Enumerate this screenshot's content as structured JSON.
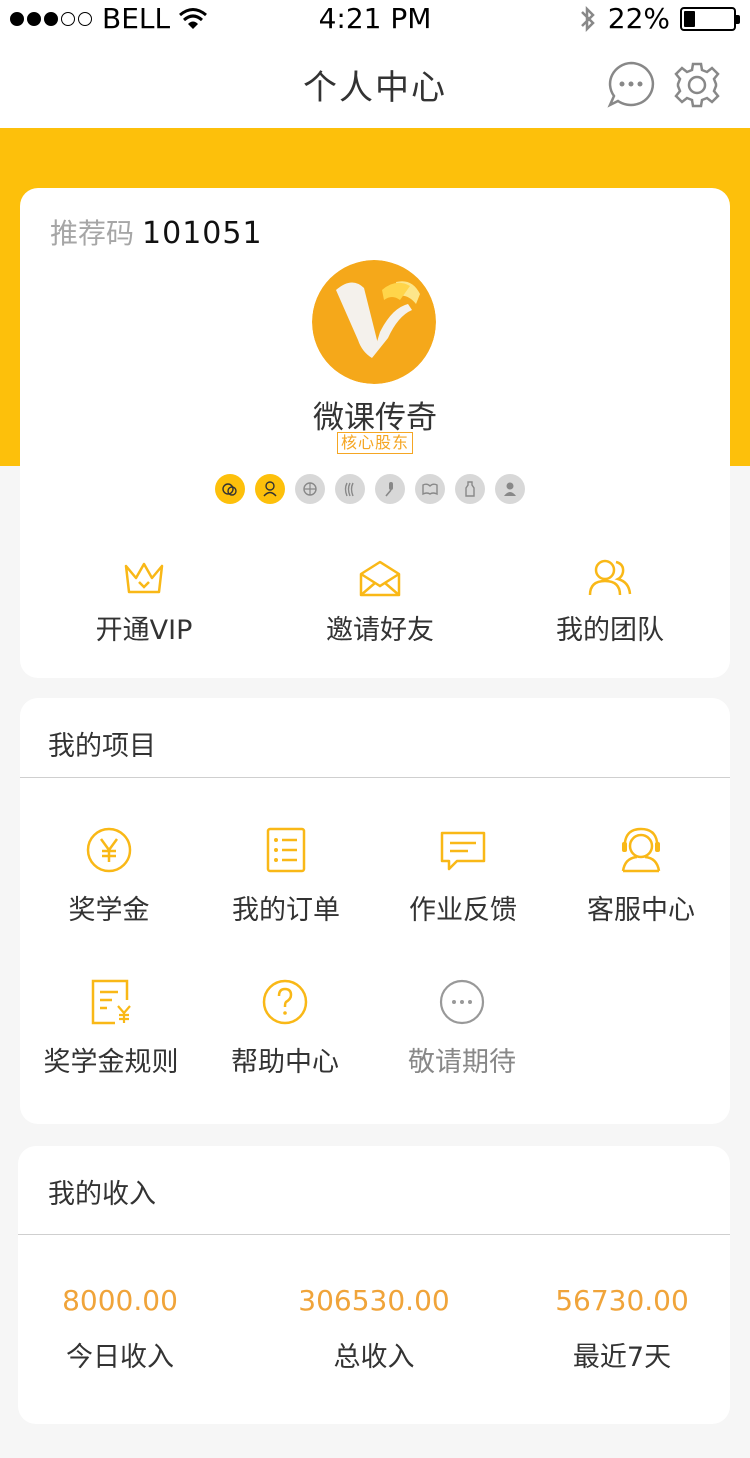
{
  "status_bar": {
    "carrier": "BELL",
    "time": "4:21 PM",
    "battery_percent": "22%",
    "battery_level": 0.22
  },
  "nav": {
    "title": "个人中心",
    "icons": [
      "message-icon",
      "gear-icon"
    ]
  },
  "profile": {
    "ref_label": "推荐码",
    "ref_code": "101051",
    "name": "微课传奇",
    "role": "核心股东",
    "badges": [
      {
        "icon": "wechat-icon",
        "active": true
      },
      {
        "icon": "person-chat-icon",
        "active": true
      },
      {
        "icon": "globe-icon",
        "active": false
      },
      {
        "icon": "hair-icon",
        "active": false
      },
      {
        "icon": "microphone-icon",
        "active": false
      },
      {
        "icon": "book-icon",
        "active": false
      },
      {
        "icon": "bottle-icon",
        "active": false
      },
      {
        "icon": "user-icon",
        "active": false
      }
    ]
  },
  "quick_actions": [
    {
      "label": "开通VIP",
      "icon": "crown-icon"
    },
    {
      "label": "邀请好友",
      "icon": "envelope-icon"
    },
    {
      "label": "我的团队",
      "icon": "team-icon"
    }
  ],
  "projects": {
    "title": "我的项目",
    "items": [
      {
        "label": "奖学金",
        "icon": "yen-circle-icon"
      },
      {
        "label": "我的订单",
        "icon": "order-list-icon"
      },
      {
        "label": "作业反馈",
        "icon": "message-square-icon"
      },
      {
        "label": "客服中心",
        "icon": "headset-icon"
      },
      {
        "label": "奖学金规则",
        "icon": "yen-document-icon"
      },
      {
        "label": "帮助中心",
        "icon": "question-circle-icon"
      },
      {
        "label": "敬请期待",
        "icon": "more-circle-icon"
      }
    ]
  },
  "income": {
    "title": "我的收入",
    "items": [
      {
        "value": "8000.00",
        "label": "今日收入"
      },
      {
        "value": "306530.00",
        "label": "总收入"
      },
      {
        "value": "56730.00",
        "label": "最近7天"
      }
    ]
  },
  "colors": {
    "brand_yellow": "#fdc00b",
    "accent_orange": "#f0a43a",
    "icon_yellow": "#f9b817"
  }
}
